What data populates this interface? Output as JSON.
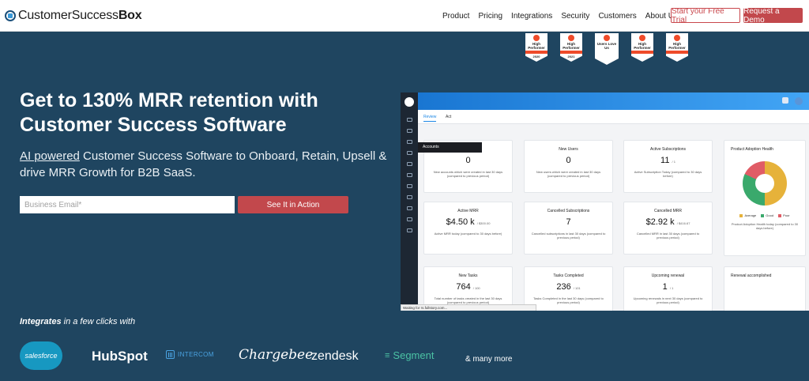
{
  "brand": {
    "name_regular": "CustomerSuccess",
    "name_bold": "Box"
  },
  "nav": {
    "links": [
      "Product",
      "Pricing",
      "Integrations",
      "Security",
      "Customers",
      "About Us"
    ],
    "trial_label": "Start your Free Trial",
    "demo_label": "Request a Demo"
  },
  "badges": [
    {
      "title": "High Performer",
      "year": "2020"
    },
    {
      "title": "High Performer",
      "year": "2021"
    },
    {
      "title": "Users Love Us",
      "year": ""
    },
    {
      "title": "High Performer",
      "year": ""
    },
    {
      "title": "High Performer",
      "year": ""
    }
  ],
  "hero": {
    "title": "Get to 130% MRR retention with Customer Success Software",
    "sub_link": "AI powered",
    "sub_rest": " Customer Success Software to Onboard, Retain, Upsell & drive MRR Growth for B2B SaaS.",
    "email_placeholder": "Business Email*",
    "cta_label": "See It in Action"
  },
  "app": {
    "tabs": [
      "Review",
      "Act"
    ],
    "tooltip": "Accounts",
    "status": "Waiting for rs.fullstory.com...",
    "cards": [
      {
        "title": "Accounts",
        "value": "0",
        "sub": "",
        "desc": "New accounts which were created in last 30 days (compared to previous period)"
      },
      {
        "title": "New Users",
        "value": "0",
        "sub": "",
        "desc": "New users which were created in last 30 days (compared to previous period)"
      },
      {
        "title": "Active Subscriptions",
        "value": "11",
        "sub": "/ 1",
        "desc": "Active Subscription Today (compared to 30 days before)"
      },
      {
        "title": "Active MRR",
        "value": "$4.50 k",
        "sub": "/ $300.00",
        "desc": "Active MRR today (compared to 30 days before)"
      },
      {
        "title": "Cancelled Subscriptions",
        "value": "7",
        "sub": "",
        "desc": "Cancelled subscriptions in last 30 days (compared to previous period)"
      },
      {
        "title": "Cancelled MRR",
        "value": "$2.92 k",
        "sub": "/ $416.67",
        "desc": "Cancelled MRR in last 30 days (compared to previous period)"
      },
      {
        "title": "New Tasks",
        "value": "764",
        "sub": "/ 100",
        "desc": "Total number of tasks created in the last 30 days (compared to previous period)"
      },
      {
        "title": "Tasks Completed",
        "value": "236",
        "sub": "/ 101",
        "desc": "Tasks Completed in the last 30 days (compared to previous period)"
      },
      {
        "title": "Upcoming renewal",
        "value": "1",
        "sub": "/ 1",
        "desc": "Upcoming renewals in next 30 days (compared to previous period)"
      }
    ],
    "adoption": {
      "title": "Product Adoption Health",
      "legend": [
        "Average",
        "Good",
        "Poor"
      ],
      "desc": "Product Adoption Health today (compared to 30 days before)",
      "shares": [
        0.5,
        0.32,
        0.18
      ],
      "colors": [
        "#e6b23a",
        "#3aa96c",
        "#e05c66"
      ]
    },
    "renewal": {
      "title": "Renewal accomplished"
    }
  },
  "integrations": {
    "label_bold": "Integrates",
    "label_rest": " in a few clicks with",
    "logos": [
      "salesforce",
      "HubSpot",
      "INTERCOM",
      "Chargebee",
      "zendesk",
      "Segment"
    ],
    "more": "& many more"
  }
}
